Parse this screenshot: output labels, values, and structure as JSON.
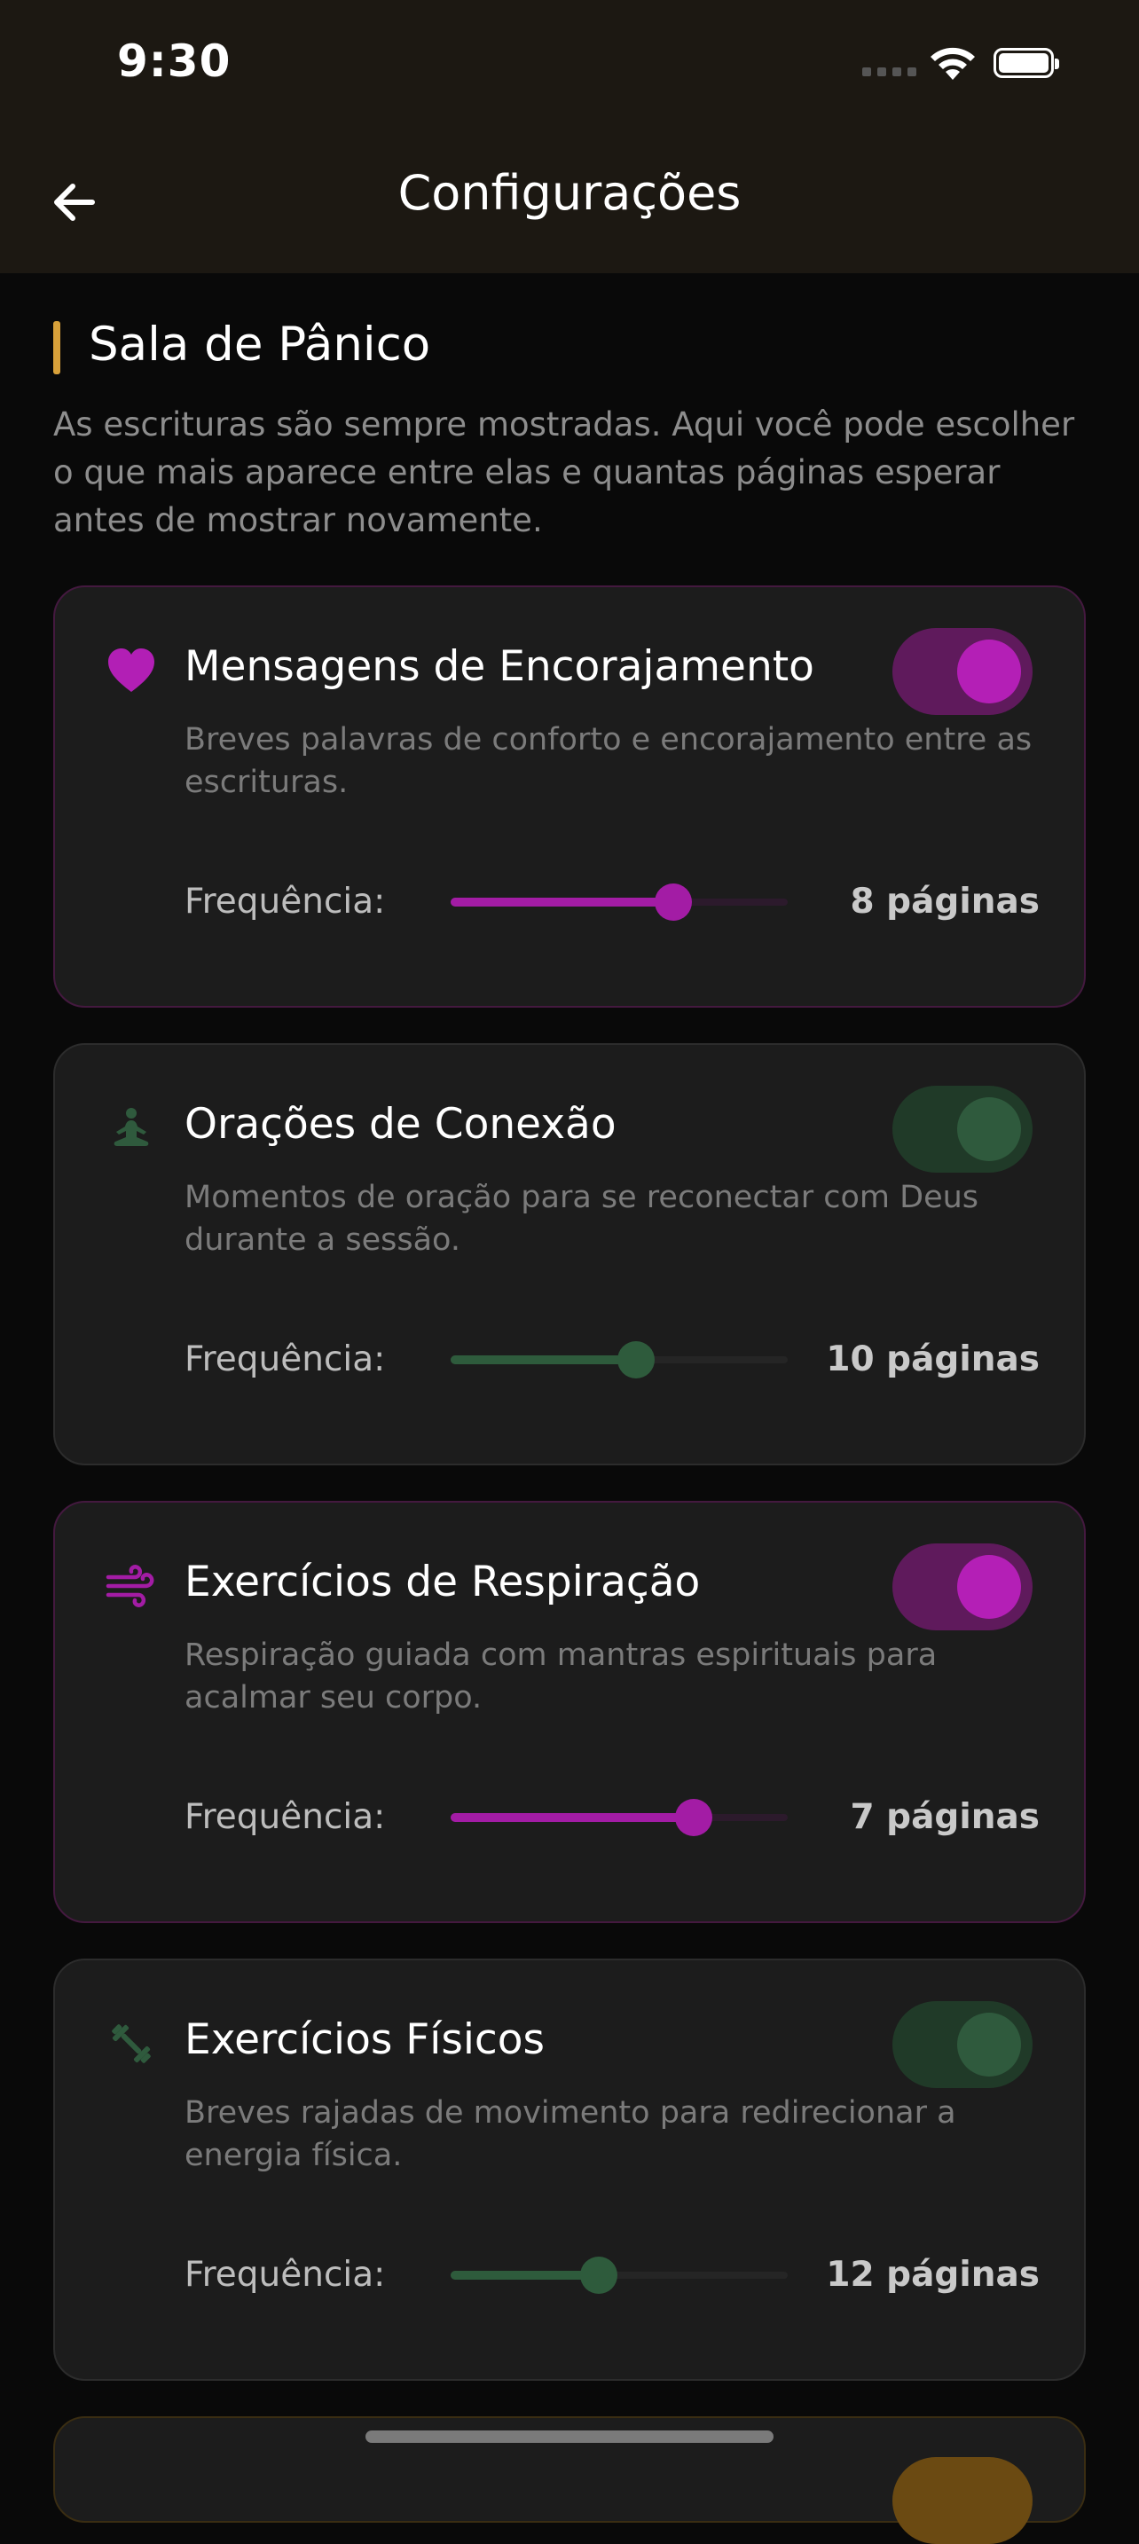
{
  "status_bar": {
    "time": "9:30"
  },
  "header": {
    "title": "Configurações",
    "back_icon": "arrow-left-icon"
  },
  "section": {
    "title": "Sala de Pânico",
    "description": "As escrituras são sempre mostradas. Aqui você pode escolher o que mais aparece entre elas e quantas páginas esperar antes de mostrar novamente."
  },
  "cards": [
    {
      "icon": "heart-icon",
      "title": "Mensagens de Encorajamento",
      "description": "Breves palavras de conforto e encorajamento entre as escrituras.",
      "enabled": true,
      "frequency_label": "Frequência:",
      "frequency_value": "8 páginas",
      "slider_fraction": 0.66,
      "accent": "#a31ca5"
    },
    {
      "icon": "meditation-icon",
      "title": "Orações de Conexão",
      "description": "Momentos de oração para se reconectar com Deus durante a sessão.",
      "enabled": true,
      "frequency_label": "Frequência:",
      "frequency_value": "10 páginas",
      "slider_fraction": 0.55,
      "accent": "#2e5b3c"
    },
    {
      "icon": "wind-icon",
      "title": "Exercícios de Respiração",
      "description": "Respiração guiada com mantras espirituais para acalmar seu corpo.",
      "enabled": true,
      "frequency_label": "Frequência:",
      "frequency_value": "7 páginas",
      "slider_fraction": 0.72,
      "accent": "#a31ca5"
    },
    {
      "icon": "dumbbell-icon",
      "title": "Exercícios Físicos",
      "description": "Breves rajadas de movimento para redirecionar a energia física.",
      "enabled": true,
      "frequency_label": "Frequência:",
      "frequency_value": "12 páginas",
      "slider_fraction": 0.44,
      "accent": "#2e5b3c"
    }
  ],
  "colors": {
    "section_accent": "#d8a13a",
    "background": "#090909",
    "card": "#1c1c1c"
  }
}
